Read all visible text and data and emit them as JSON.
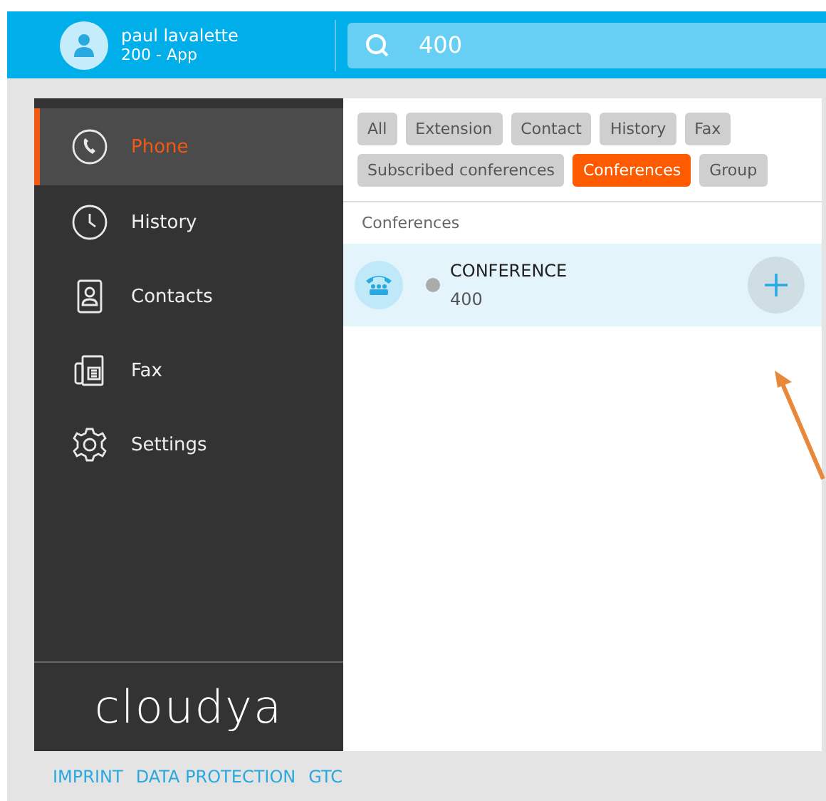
{
  "user": {
    "name": "paul lavalette",
    "extension": "200 - App"
  },
  "search": {
    "value": "400"
  },
  "nav": [
    {
      "label": "Phone",
      "kind": "phone",
      "selected": true
    },
    {
      "label": "History",
      "kind": "history",
      "selected": false
    },
    {
      "label": "Contacts",
      "kind": "contacts",
      "selected": false
    },
    {
      "label": "Fax",
      "kind": "fax",
      "selected": false
    },
    {
      "label": "Settings",
      "kind": "settings",
      "selected": false
    }
  ],
  "logo": "cloudya",
  "filters": [
    {
      "label": "All",
      "selected": false
    },
    {
      "label": "Extension",
      "selected": false
    },
    {
      "label": "Contact",
      "selected": false
    },
    {
      "label": "History",
      "selected": false
    },
    {
      "label": "Fax",
      "selected": false
    },
    {
      "label": "Subscribed conferences",
      "selected": false
    },
    {
      "label": "Conferences",
      "selected": true
    },
    {
      "label": "Group",
      "selected": false
    }
  ],
  "section_title": "Conferences",
  "results": [
    {
      "name": "CONFERENCE",
      "number": "400",
      "online": false
    }
  ],
  "footer_links": [
    "IMPRINT",
    "DATA PROTECTION",
    "GTC"
  ]
}
